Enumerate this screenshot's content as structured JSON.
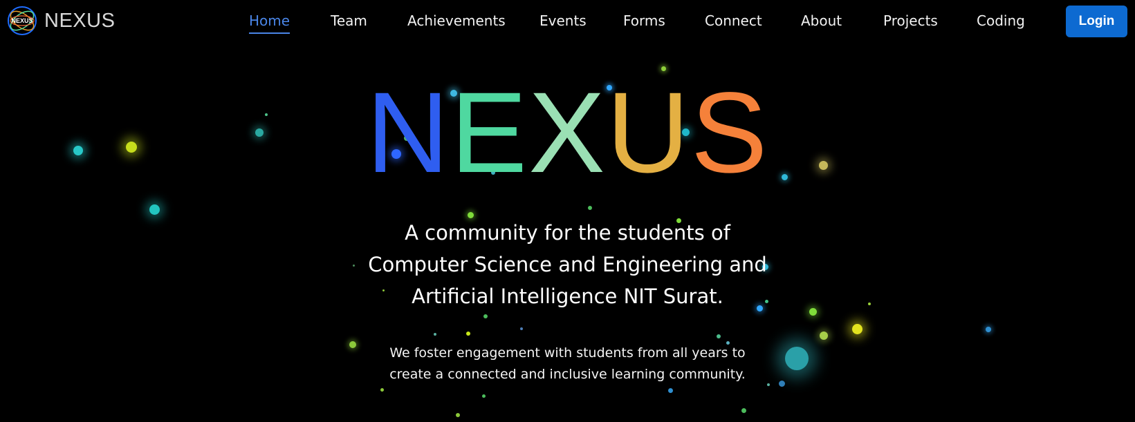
{
  "brand": {
    "name": "NEXUS",
    "logo_text": "NEXUS",
    "logo_icon": "nexus-ring-logo-icon"
  },
  "nav": {
    "items": [
      {
        "label": "Home",
        "active": true
      },
      {
        "label": "Team",
        "active": false
      },
      {
        "label": "Achievements",
        "active": false
      },
      {
        "label": "Events",
        "active": false
      },
      {
        "label": "Forms",
        "active": false
      },
      {
        "label": "Connect",
        "active": false
      },
      {
        "label": "About",
        "active": false
      },
      {
        "label": "Projects",
        "active": false
      },
      {
        "label": "Coding",
        "active": false
      }
    ],
    "login_label": "Login"
  },
  "hero": {
    "title_letters": [
      "N",
      "E",
      "X",
      "U",
      "S"
    ],
    "tagline_lines": [
      "A community for the students of",
      "Computer Science and Engineering and",
      "Artificial Intelligence NIT Surat."
    ],
    "description_lines": [
      "We foster engagement with students from all years to",
      "create a connected and inclusive learning community."
    ]
  },
  "colors": {
    "background": "#000000",
    "accent": "#4a86e8",
    "login_button": "#0d6ad1",
    "title_gradient": [
      "#2f5ef0",
      "#3c8ae6",
      "#6fe7a8",
      "#8ce6c0",
      "#d8c050",
      "#f2a23a",
      "#f57a3a"
    ],
    "particle_colors": [
      "#1fc6c9",
      "#c8e81a",
      "#3fb7e0",
      "#7fdc3a",
      "#e3e31f",
      "#31a7ff"
    ]
  }
}
